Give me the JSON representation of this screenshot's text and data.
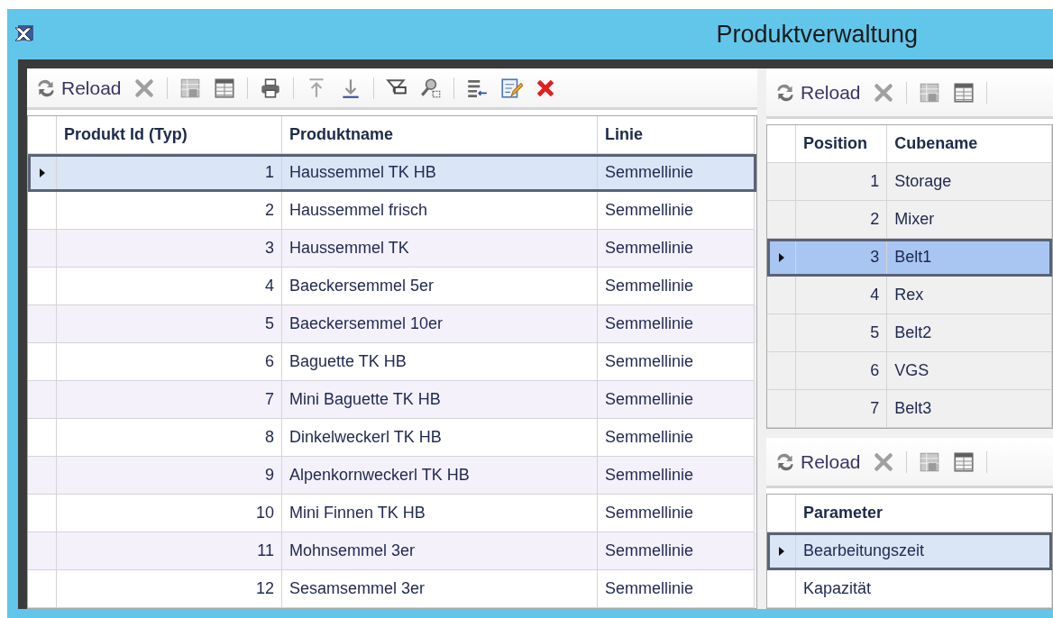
{
  "window": {
    "title": "Produktverwaltung"
  },
  "products": {
    "toolbar": {
      "reload": "Reload"
    },
    "columns": [
      "Produkt Id (Typ)",
      "Produktname",
      "Linie"
    ],
    "rows": [
      {
        "cells": [
          "1",
          "Haussemmel TK HB",
          "Semmellinie"
        ],
        "selected": true
      },
      {
        "cells": [
          "2",
          "Haussemmel frisch",
          "Semmellinie"
        ],
        "selected": false
      },
      {
        "cells": [
          "3",
          "Haussemmel TK",
          "Semmellinie"
        ],
        "selected": false
      },
      {
        "cells": [
          "4",
          "Baeckersemmel 5er",
          "Semmellinie"
        ],
        "selected": false
      },
      {
        "cells": [
          "5",
          "Baeckersemmel 10er",
          "Semmellinie"
        ],
        "selected": false
      },
      {
        "cells": [
          "6",
          "Baguette TK HB",
          "Semmellinie"
        ],
        "selected": false
      },
      {
        "cells": [
          "7",
          "Mini Baguette TK HB",
          "Semmellinie"
        ],
        "selected": false
      },
      {
        "cells": [
          "8",
          "Dinkelweckerl TK HB",
          "Semmellinie"
        ],
        "selected": false
      },
      {
        "cells": [
          "9",
          "Alpenkornweckerl TK HB",
          "Semmellinie"
        ],
        "selected": false
      },
      {
        "cells": [
          "10",
          "Mini Finnen TK HB",
          "Semmellinie"
        ],
        "selected": false
      },
      {
        "cells": [
          "11",
          "Mohnsemmel 3er",
          "Semmellinie"
        ],
        "selected": false
      },
      {
        "cells": [
          "12",
          "Sesamsemmel 3er",
          "Semmellinie"
        ],
        "selected": false
      }
    ]
  },
  "cubes": {
    "toolbar": {
      "reload": "Reload"
    },
    "columns": [
      "Position",
      "Cubename"
    ],
    "rows": [
      {
        "cells": [
          "1",
          "Storage"
        ],
        "selected": false
      },
      {
        "cells": [
          "2",
          "Mixer"
        ],
        "selected": false
      },
      {
        "cells": [
          "3",
          "Belt1"
        ],
        "selected": true
      },
      {
        "cells": [
          "4",
          "Rex"
        ],
        "selected": false
      },
      {
        "cells": [
          "5",
          "Belt2"
        ],
        "selected": false
      },
      {
        "cells": [
          "6",
          "VGS"
        ],
        "selected": false
      },
      {
        "cells": [
          "7",
          "Belt3"
        ],
        "selected": false
      }
    ]
  },
  "parameters": {
    "toolbar": {
      "reload": "Reload"
    },
    "columns": [
      "Parameter"
    ],
    "rows": [
      {
        "cells": [
          "Bearbeitungszeit"
        ],
        "selected": true
      },
      {
        "cells": [
          "Kapazität"
        ],
        "selected": false
      }
    ]
  }
}
